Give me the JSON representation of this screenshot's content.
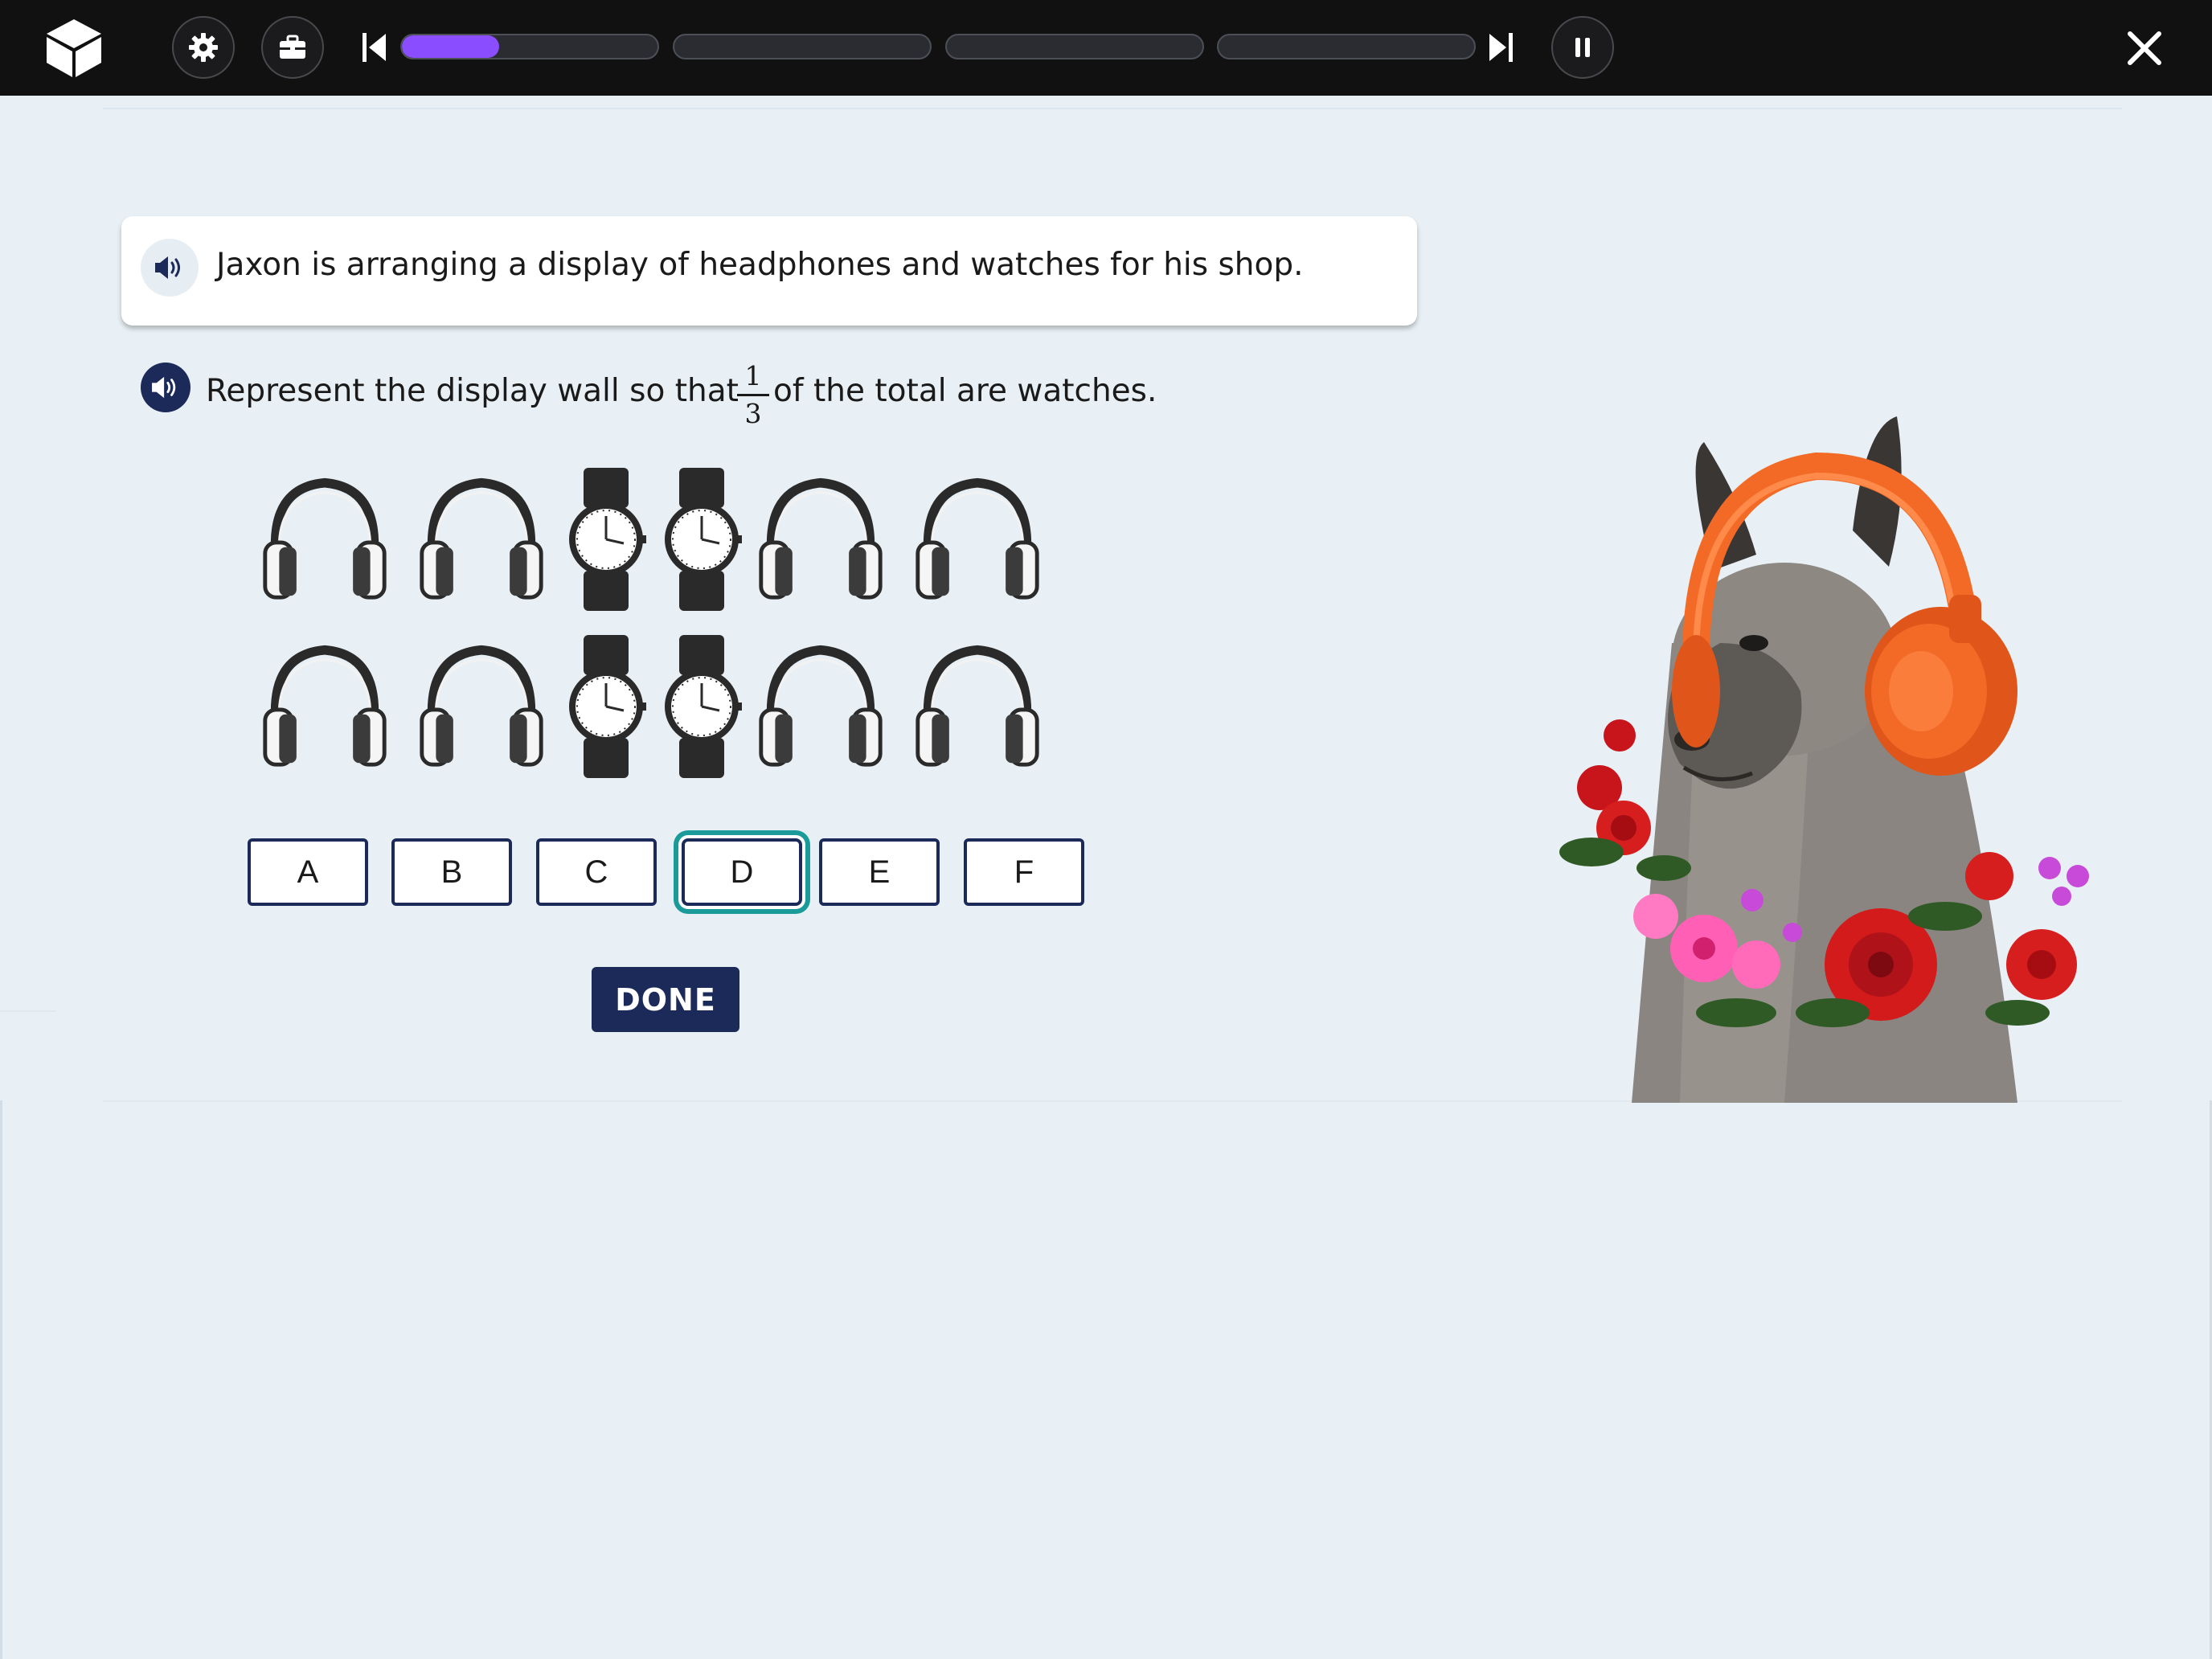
{
  "topbar": {
    "progress": {
      "segments": 4,
      "current_segment_fill": 0.38
    },
    "icons": [
      "cube-logo-icon",
      "gear-icon",
      "briefcase-icon",
      "skip-back-icon",
      "skip-forward-icon",
      "pause-icon",
      "close-icon"
    ]
  },
  "question": {
    "prompt": "Jaxon is arranging a display of headphones and watches for his shop.",
    "instruction_before": "Represent the display wall so that",
    "fraction": {
      "numerator": "1",
      "denominator": "3"
    },
    "instruction_after": "of the total are watches."
  },
  "grid": {
    "rows": [
      [
        "headphones",
        "headphones",
        "watch",
        "watch",
        "headphones",
        "headphones"
      ],
      [
        "headphones",
        "headphones",
        "watch",
        "watch",
        "headphones",
        "headphones"
      ]
    ]
  },
  "choices": [
    {
      "label": "A",
      "selected": false
    },
    {
      "label": "B",
      "selected": false
    },
    {
      "label": "C",
      "selected": false
    },
    {
      "label": "D",
      "selected": true
    },
    {
      "label": "E",
      "selected": false
    },
    {
      "label": "F",
      "selected": false
    }
  ],
  "done_label": "DONE",
  "colors": {
    "topbar": "#111111",
    "background": "#e8f0f5",
    "progress_fill": "#8a4dff",
    "navy": "#1c2a5a",
    "selected_ring": "#1b9a9a",
    "headphone_accent": "#f26a26"
  }
}
